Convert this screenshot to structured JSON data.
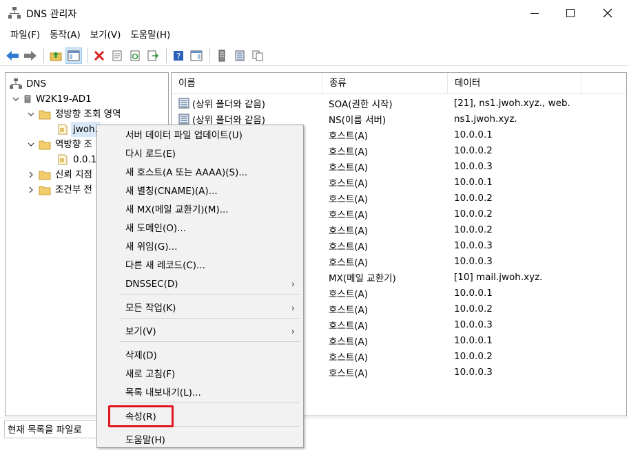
{
  "window": {
    "title": "DNS 관리자"
  },
  "menu": [
    "파일(F)",
    "동작(A)",
    "보기(V)",
    "도움말(H)"
  ],
  "toolbar": {
    "icons": [
      "back-arrow-icon",
      "forward-arrow-icon",
      "up-folder-icon",
      "show-hide-tree-icon",
      "delete-icon",
      "properties-icon",
      "refresh-icon",
      "export-list-icon",
      "help-icon",
      "show-hide-action-pane-icon",
      "server-icon",
      "zone-list-icon",
      "copy-icon"
    ]
  },
  "tree": {
    "root": "DNS",
    "server": "W2K19-AD1",
    "forward_zone": "정방향 조회 영역",
    "zone": "jwoh.",
    "reverse_zone": "역방향 조",
    "reverse_sub": "0.0.1",
    "trust": "신뢰 지점",
    "conditional": "조건부 전"
  },
  "list": {
    "headers": [
      "이름",
      "종류",
      "데이터"
    ],
    "rows": [
      {
        "name": "(상위 폴더와 같음)",
        "type": "SOA(권한 시작)",
        "data": "[21], ns1.jwoh.xyz., web."
      },
      {
        "name": "(상위 폴더와 같음)",
        "type": "NS(이름 서버)",
        "data": "ns1.jwoh.xyz."
      },
      {
        "name": "",
        "type": "호스트(A)",
        "data": "10.0.0.1"
      },
      {
        "name": "",
        "type": "호스트(A)",
        "data": "10.0.0.2"
      },
      {
        "name": "",
        "type": "호스트(A)",
        "data": "10.0.0.3"
      },
      {
        "name": "",
        "type": "호스트(A)",
        "data": "10.0.0.1"
      },
      {
        "name": "",
        "type": "호스트(A)",
        "data": "10.0.0.2"
      },
      {
        "name": "",
        "type": "호스트(A)",
        "data": "10.0.0.2"
      },
      {
        "name": "",
        "type": "호스트(A)",
        "data": "10.0.0.2"
      },
      {
        "name": "",
        "type": "호스트(A)",
        "data": "10.0.0.3"
      },
      {
        "name": "",
        "type": "호스트(A)",
        "data": "10.0.0.3"
      },
      {
        "name": "",
        "type": "MX(메일 교환기)",
        "data": "[10]  mail.jwoh.xyz."
      },
      {
        "name": "",
        "type": "호스트(A)",
        "data": "10.0.0.1"
      },
      {
        "name": "",
        "type": "호스트(A)",
        "data": "10.0.0.2"
      },
      {
        "name": "",
        "type": "호스트(A)",
        "data": "10.0.0.3"
      },
      {
        "name": "",
        "type": "호스트(A)",
        "data": "10.0.0.1"
      },
      {
        "name": "",
        "type": "호스트(A)",
        "data": "10.0.0.2"
      },
      {
        "name": "",
        "type": "호스트(A)",
        "data": "10.0.0.3"
      }
    ]
  },
  "context_menu": {
    "items": [
      "서버 데이터 파일 업데이트(U)",
      "다시 로드(E)",
      "새 호스트(A 또는 AAAA)(S)...",
      "새 별칭(CNAME)(A)...",
      "새 MX(메일 교환기)(M)...",
      "새 도메인(O)...",
      "새 위임(G)...",
      "다른 새 레코드(C)...",
      "DNSSEC(D)",
      "모든 작업(K)",
      "보기(V)",
      "삭제(D)",
      "새로 고침(F)",
      "목록 내보내기(L)...",
      "속성(R)",
      "도움말(H)"
    ],
    "submenu_arrow": "›"
  },
  "status": {
    "text": "현재 목록을 파일로"
  },
  "colors": {
    "highlight_box": "#e0161c",
    "selection": "#d9e8f7",
    "menu_bg": "#f2f2f2"
  }
}
